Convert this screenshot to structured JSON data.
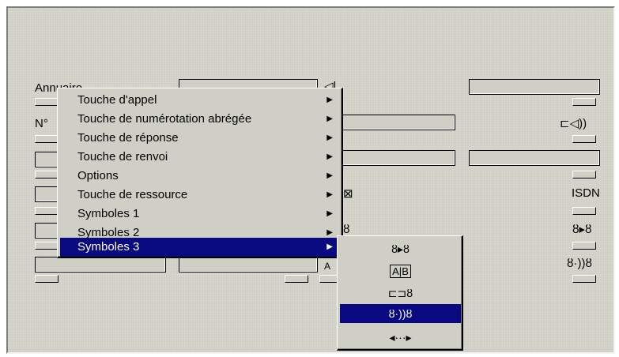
{
  "form": {
    "label_annuaire": "Annuaire",
    "label_no": "N°",
    "label_isdn": "ISDN"
  },
  "context_menu": {
    "items": [
      {
        "label": "Touche d'appel"
      },
      {
        "label": "Touche de numérotation abrégée"
      },
      {
        "label": "Touche de réponse"
      },
      {
        "label": "Touche de renvoi"
      },
      {
        "label": "Options"
      },
      {
        "label": "Touche de ressource"
      },
      {
        "label": "Symboles 1"
      },
      {
        "label": "Symboles 2"
      },
      {
        "label": "Symboles 3",
        "selected": true
      }
    ],
    "arrow": "▶"
  },
  "submenu": {
    "items": [
      {
        "symbol": "person-arrow-person",
        "text": "ȣ▸ȣ"
      },
      {
        "symbol": "ab-box",
        "text": "A|B"
      },
      {
        "symbol": "book-person",
        "text": "⊏⊐ȣ"
      },
      {
        "symbol": "person-speak-person",
        "text": "ȣ·))ȣ",
        "selected": true
      },
      {
        "symbol": "double-arrow",
        "text": "◂···▸"
      }
    ]
  },
  "colors": {
    "panel": "#cfcfc6",
    "selection": "#0a0a80"
  }
}
